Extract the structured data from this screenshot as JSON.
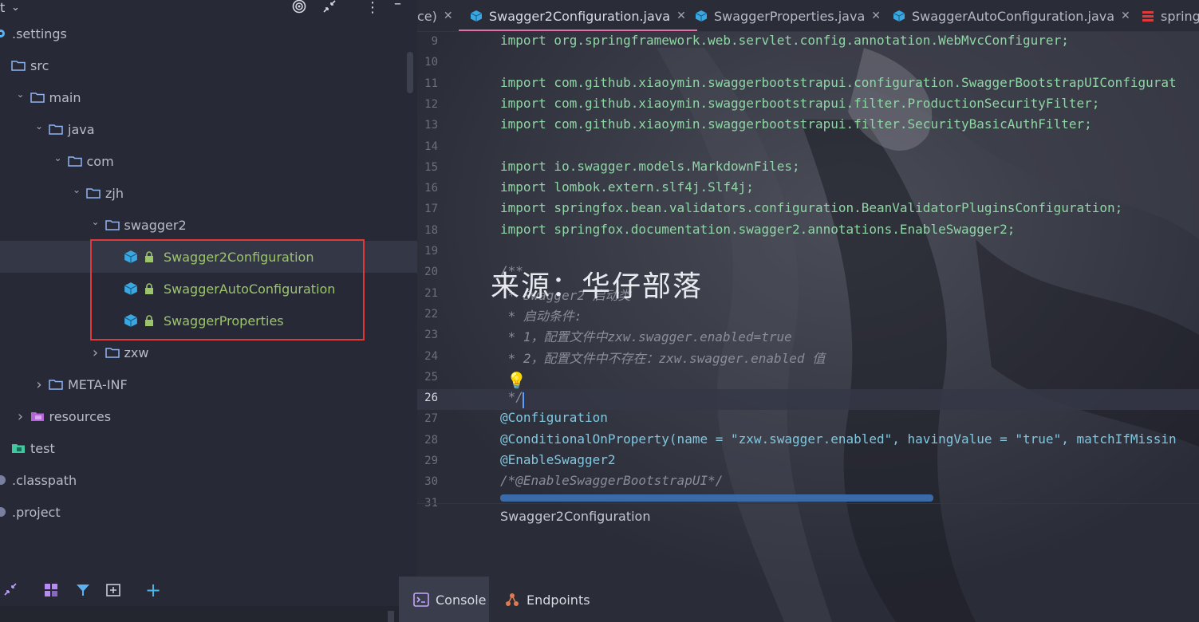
{
  "project_panel": {
    "title": "t",
    "chevron": "chevron-down-icon",
    "toolbar_icons": [
      "target-icon",
      "collapse-icon",
      "more-vertical-icon",
      "minimize-icon"
    ],
    "tree": [
      {
        "label": ".settings",
        "icon": "gear-icon",
        "depth": 0
      },
      {
        "label": "src",
        "icon": "folder-icon",
        "depth": 0
      },
      {
        "label": "main",
        "icon": "folder-icon",
        "depth": 1,
        "expanded": true
      },
      {
        "label": "java",
        "icon": "folder-icon",
        "depth": 2,
        "expanded": true
      },
      {
        "label": "com",
        "icon": "folder-icon",
        "depth": 3,
        "expanded": true
      },
      {
        "label": "zjh",
        "icon": "folder-icon",
        "depth": 4,
        "expanded": true
      },
      {
        "label": "swagger2",
        "icon": "folder-icon",
        "depth": 5,
        "expanded": true
      },
      {
        "label": "Swagger2Configuration",
        "icon": "class-icon",
        "depth": 6,
        "selected": true
      },
      {
        "label": "SwaggerAutoConfiguration",
        "icon": "class-icon",
        "depth": 6
      },
      {
        "label": "SwaggerProperties",
        "icon": "class-icon",
        "depth": 6
      },
      {
        "label": "zxw",
        "icon": "folder-icon",
        "depth": 5,
        "expanded": false
      },
      {
        "label": "META-INF",
        "icon": "folder-icon",
        "depth": 2,
        "expanded": false
      },
      {
        "label": "resources",
        "icon": "resources-folder-icon",
        "depth": 1,
        "expanded": false
      },
      {
        "label": "test",
        "icon": "test-folder-icon",
        "depth": 0
      },
      {
        "label": ".classpath",
        "icon": "file-icon",
        "depth": 0
      },
      {
        "label": ".project",
        "icon": "file-icon",
        "depth": 0
      }
    ],
    "bottom_icons": [
      "collapse-icon",
      "layout-icon",
      "filter-icon",
      "add-window-icon",
      "add-icon"
    ]
  },
  "editor": {
    "tabs": [
      {
        "label": "ce)",
        "partial": true
      },
      {
        "label": "Swagger2Configuration.java",
        "active": true
      },
      {
        "label": "SwaggerProperties.java"
      },
      {
        "label": "SwaggerAutoConfiguration.java"
      },
      {
        "label": "spring",
        "partial": true
      }
    ],
    "watermark": "来源：华仔部落",
    "lines": [
      {
        "n": "9",
        "text": "import org.springframework.web.servlet.config.annotation.WebMvcConfigurer;"
      },
      {
        "n": "10",
        "text": ""
      },
      {
        "n": "11",
        "text": "import com.github.xiaoymin.swaggerbootstrapui.configuration.SwaggerBootstrapUIConfigurat"
      },
      {
        "n": "12",
        "text": "import com.github.xiaoymin.swaggerbootstrapui.filter.ProductionSecurityFilter;"
      },
      {
        "n": "13",
        "text": "import com.github.xiaoymin.swaggerbootstrapui.filter.SecurityBasicAuthFilter;"
      },
      {
        "n": "14",
        "text": ""
      },
      {
        "n": "15",
        "text": "import io.swagger.models.MarkdownFiles;"
      },
      {
        "n": "16",
        "text": "import lombok.extern.slf4j.Slf4j;"
      },
      {
        "n": "17",
        "text": "import springfox.bean.validators.configuration.BeanValidatorPluginsConfiguration;"
      },
      {
        "n": "18",
        "text": "import springfox.documentation.swagger2.annotations.EnableSwagger2;"
      },
      {
        "n": "19",
        "text": ""
      },
      {
        "n": "20",
        "text": "/**"
      },
      {
        "n": "21",
        "text": " * Swagger2 启动类"
      },
      {
        "n": "22",
        "text": " * 启动条件:"
      },
      {
        "n": "23",
        "text": " * 1，配置文件中zxw.swagger.enabled=true"
      },
      {
        "n": "24",
        "text": " * 2，配置文件中不存在：zxw.swagger.enabled 值"
      },
      {
        "n": "25",
        "text": ""
      },
      {
        "n": "26",
        "text": " */"
      },
      {
        "n": "27",
        "text": "@Configuration"
      },
      {
        "n": "28",
        "text": "@ConditionalOnProperty(name = \"zxw.swagger.enabled\", havingValue = \"true\", matchIfMissin"
      },
      {
        "n": "29",
        "text": "@EnableSwagger2"
      },
      {
        "n": "30",
        "text": "/*@EnableSwaggerBootstrapUI*/"
      },
      {
        "n": "31",
        "text": ""
      }
    ],
    "current_line": "26",
    "breadcrumb": "Swagger2Configuration"
  },
  "bottom_tools": [
    {
      "label": "Console",
      "icon": "console-icon",
      "active": true
    },
    {
      "label": "Endpoints",
      "icon": "endpoints-icon"
    }
  ],
  "colors": {
    "accent_tab": "#e070a8",
    "selection_box": "#e0393a",
    "class_icon": "#3aa7e0"
  }
}
